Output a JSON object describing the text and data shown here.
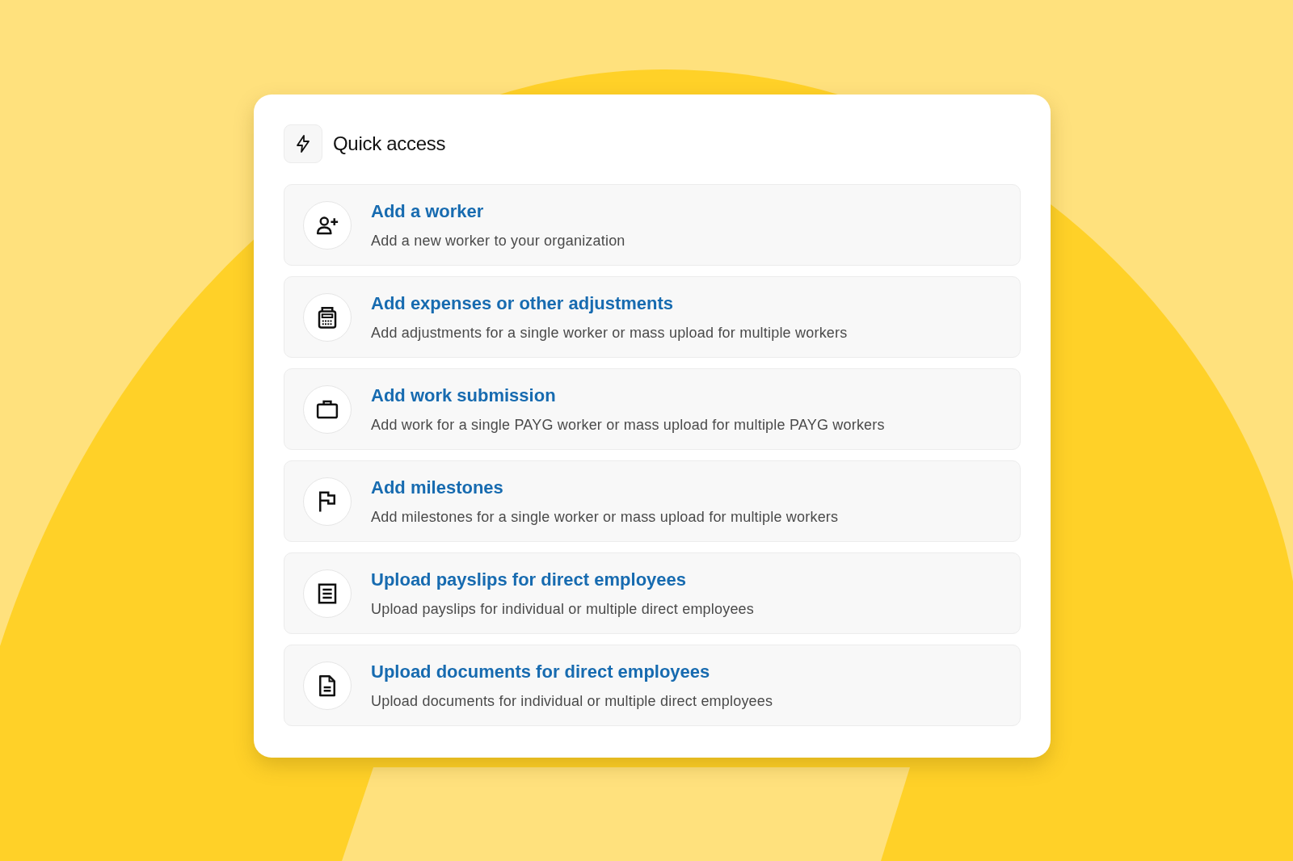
{
  "panel": {
    "title": "Quick access"
  },
  "actions": [
    {
      "title": "Add a worker",
      "description": "Add a new worker to your organization"
    },
    {
      "title": "Add expenses or other adjustments",
      "description": "Add adjustments for a single worker or mass upload for multiple workers"
    },
    {
      "title": "Add work submission",
      "description": "Add work for a single PAYG worker or mass upload for multiple PAYG workers"
    },
    {
      "title": "Add milestones",
      "description": "Add milestones for a single worker or mass upload for multiple workers"
    },
    {
      "title": "Upload payslips for direct employees",
      "description": "Upload payslips for individual or multiple direct employees"
    },
    {
      "title": "Upload documents for direct employees",
      "description": "Upload documents for individual or multiple direct employees"
    }
  ]
}
